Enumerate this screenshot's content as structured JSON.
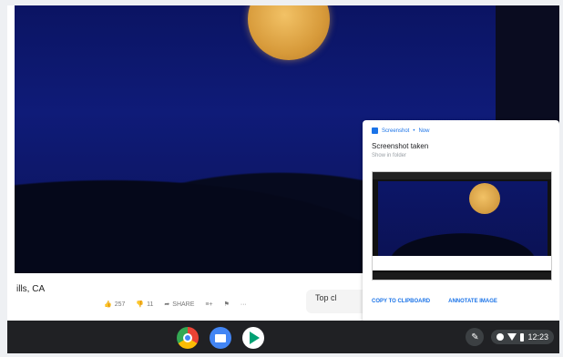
{
  "video": {
    "location": "ills, CA",
    "topc": "Top cl"
  },
  "actions": {
    "likes": "257",
    "dislikes": "11",
    "share": "SHARE"
  },
  "notification": {
    "app_name": "Screenshot",
    "app_sub": "Now",
    "title": "Screenshot taken",
    "subtitle": "Show in folder",
    "copy_label": "COPY TO CLIPBOARD",
    "annotate_label": "ANNOTATE IMAGE"
  },
  "tray": {
    "time": "12:23"
  },
  "icons": [
    "like-icon",
    "dislike-icon",
    "share-icon",
    "pen-icon",
    "wifi-icon",
    "battery-icon"
  ]
}
